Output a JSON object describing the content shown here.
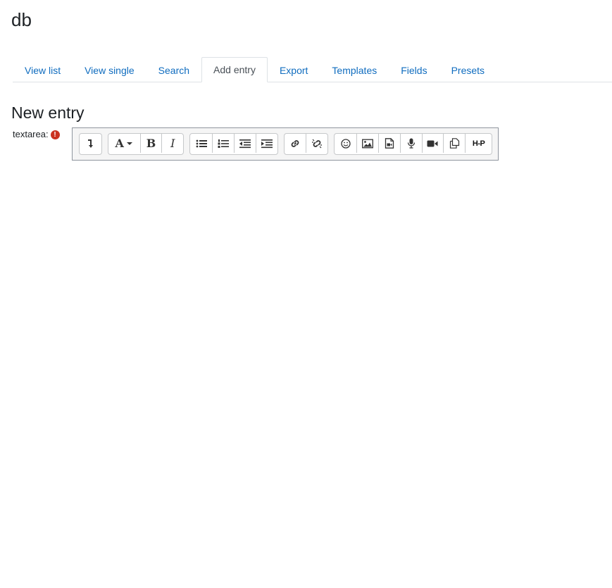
{
  "page": {
    "title": "db"
  },
  "tabs": [
    {
      "label": "View list",
      "active": false
    },
    {
      "label": "View single",
      "active": false
    },
    {
      "label": "Search",
      "active": false
    },
    {
      "label": "Add entry",
      "active": true
    },
    {
      "label": "Export",
      "active": false
    },
    {
      "label": "Templates",
      "active": false
    },
    {
      "label": "Fields",
      "active": false
    },
    {
      "label": "Presets",
      "active": false
    }
  ],
  "form": {
    "heading": "New entry",
    "field_label": "textarea:",
    "required_icon": "!"
  },
  "toolbar": {
    "groups": [
      [
        "collapse-icon"
      ],
      [
        "font-style-icon",
        "bold-icon",
        "italic-icon"
      ],
      [
        "unordered-list-icon",
        "ordered-list-icon",
        "outdent-icon",
        "indent-icon"
      ],
      [
        "link-icon",
        "unlink-icon"
      ],
      [
        "emoji-icon",
        "image-icon",
        "media-file-icon",
        "record-audio-icon",
        "record-video-icon",
        "manage-files-icon",
        "h5p-icon"
      ]
    ],
    "bold_glyph": "B",
    "italic_glyph": "I",
    "font_glyph": "A",
    "h5p_text": "H-P"
  },
  "colors": {
    "link": "#0f6cbf",
    "text": "#1d2125",
    "required": "#ca3120",
    "toolbar_bg": "#f5f5f5"
  }
}
